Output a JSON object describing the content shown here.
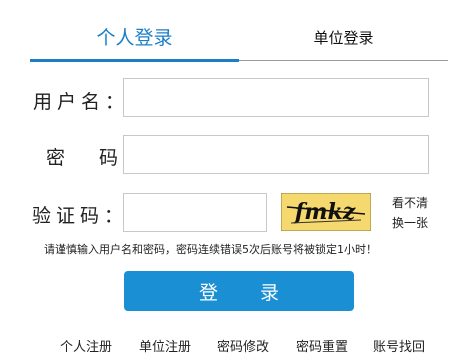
{
  "tabs": {
    "personal_label": "个人登录",
    "unit_label": "单位登录",
    "active": "personal"
  },
  "form": {
    "username_label": "用户名：",
    "password_label": "密 码：",
    "captcha_label": "验证码：",
    "username_value": "",
    "password_value": "",
    "captcha_value": "",
    "captcha_text": "fmkz",
    "refresh_line1": "看不清",
    "refresh_line2": "换一张"
  },
  "notice": "请谨慎输入用户名和密码，密码连续错误5次后账号将被锁定1小时！",
  "login_button": "登 录",
  "footer": {
    "personal_register": "个人注册",
    "unit_register": "单位注册",
    "password_change": "密码修改",
    "password_reset": "密码重置",
    "account_recover": "账号找回"
  },
  "colors": {
    "accent": "#1a7fc7",
    "button": "#1b8fd4",
    "captcha_bg": "#f5d96e"
  }
}
